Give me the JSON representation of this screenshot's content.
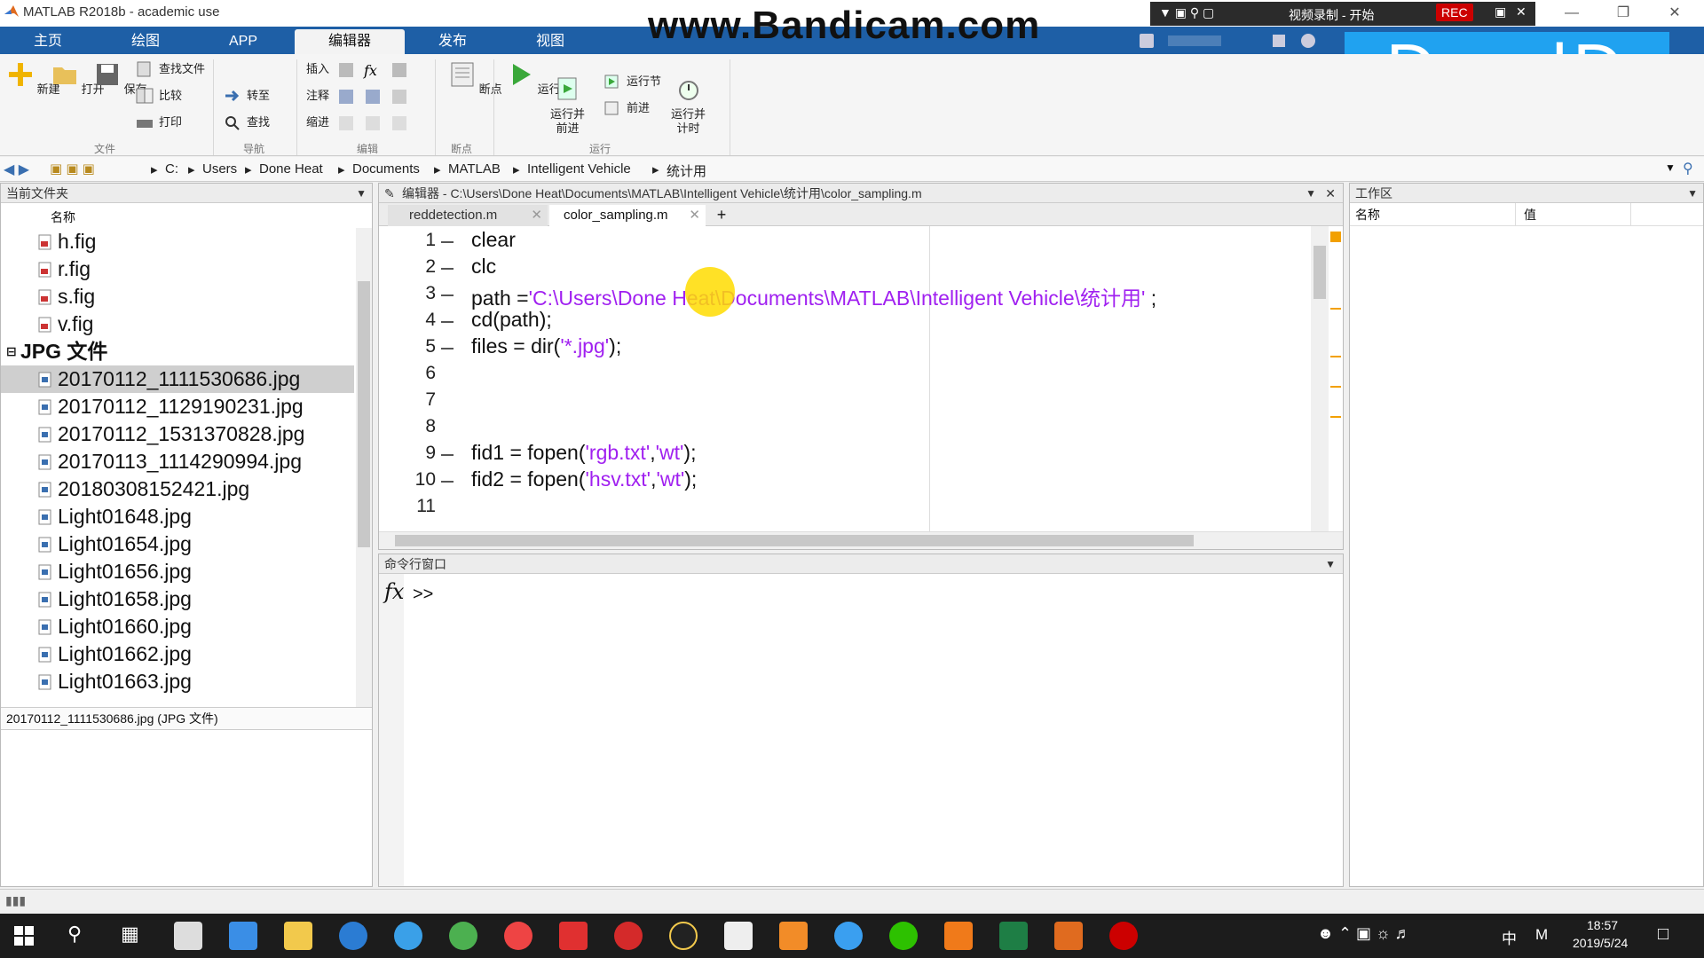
{
  "window": {
    "title": "MATLAB R2018b - academic use"
  },
  "watermark": "www.Bandicam.com",
  "recorder": {
    "title": "视频录制 - 开始",
    "rec": "REC"
  },
  "overlay_logo": "DandD",
  "ribbon_tabs": [
    "主页",
    "绘图",
    "APP",
    "编辑器",
    "发布",
    "视图"
  ],
  "ribbon": {
    "new": "新建",
    "open": "打开",
    "save": "保存",
    "find_files": "查找文件",
    "compare": "比较",
    "print": "打印",
    "goto": "转至",
    "find": "查找",
    "insert": "插入",
    "comment": "注释",
    "indent": "缩进",
    "breakpoint": "断点",
    "run": "运行",
    "run_advance": "运行并\n前进",
    "run_section": "运行节",
    "advance": "前进",
    "run_time": "运行并\n计时",
    "groups": [
      "文件",
      "导航",
      "编辑",
      "断点",
      "运行"
    ]
  },
  "address": [
    "C:",
    "Users",
    "Done Heat",
    "Documents",
    "MATLAB",
    "Intelligent Vehicle",
    "统计用"
  ],
  "current_folder": {
    "title": "当前文件夹",
    "col_name": "名称",
    "fig_files": [
      "h.fig",
      "r.fig",
      "s.fig",
      "v.fig"
    ],
    "jpg_group": "JPG 文件",
    "jpg_files": [
      "20170112_1111530686.jpg",
      "20170112_1129190231.jpg",
      "20170112_1531370828.jpg",
      "20170113_1114290994.jpg",
      "20180308152421.jpg",
      "Light01648.jpg",
      "Light01654.jpg",
      "Light01656.jpg",
      "Light01658.jpg",
      "Light01660.jpg",
      "Light01662.jpg",
      "Light01663.jpg"
    ],
    "details": "20170112_1111530686.jpg  (JPG 文件)"
  },
  "editor": {
    "title": "编辑器 - C:\\Users\\Done Heat\\Documents\\MATLAB\\Intelligent Vehicle\\统计用\\color_sampling.m",
    "tabs": [
      "reddetection.m",
      "color_sampling.m"
    ],
    "line_numbers": [
      "1",
      "2",
      "3",
      "4",
      "5",
      "6",
      "7",
      "8",
      "9",
      "10",
      "11"
    ]
  },
  "command": {
    "title": "命令行窗口",
    "prompt": ">>",
    "fx": "fx"
  },
  "workspace": {
    "title": "工作区",
    "col_name": "名称",
    "col_value": "值"
  },
  "taskbar": {
    "time": "18:57",
    "date": "2019/5/24",
    "ime": "中",
    "ime2": "M"
  }
}
